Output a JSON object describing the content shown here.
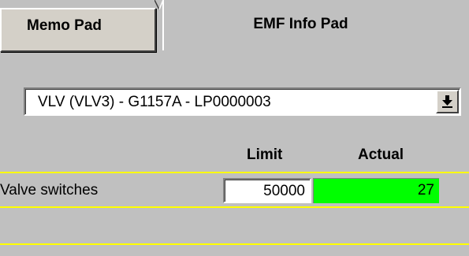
{
  "tabs": {
    "memo_pad": "Memo Pad",
    "emf_info_pad": "EMF Info Pad"
  },
  "valve_select": {
    "selected": "VLV (VLV3) - G1157A - LP0000003",
    "button_icon": "dropdown-arrow-icon"
  },
  "table": {
    "columns": {
      "limit": "Limit",
      "actual": "Actual"
    },
    "rows": [
      {
        "label": "Valve switches",
        "limit": "50000",
        "actual": "27"
      }
    ]
  },
  "colors": {
    "background": "#c0c0c0",
    "row_separator": "#ffff00",
    "actual_ok": "#00ff00"
  }
}
